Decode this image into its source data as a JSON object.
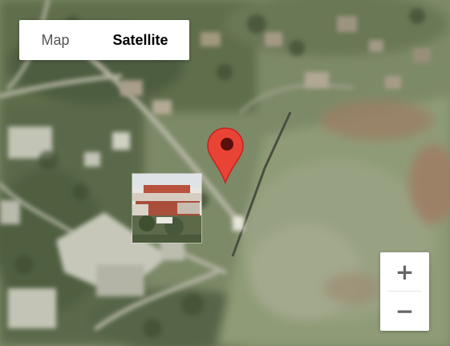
{
  "map_type_control": {
    "options": [
      "Map",
      "Satellite"
    ],
    "selected": "Satellite"
  },
  "zoom_control": {
    "zoom_in_label": "+",
    "zoom_out_label": "−"
  },
  "marker": {
    "color": "#e94335",
    "icon": "map-pin-icon"
  },
  "photo_thumbnail": {
    "icon": "street-view-photo"
  }
}
